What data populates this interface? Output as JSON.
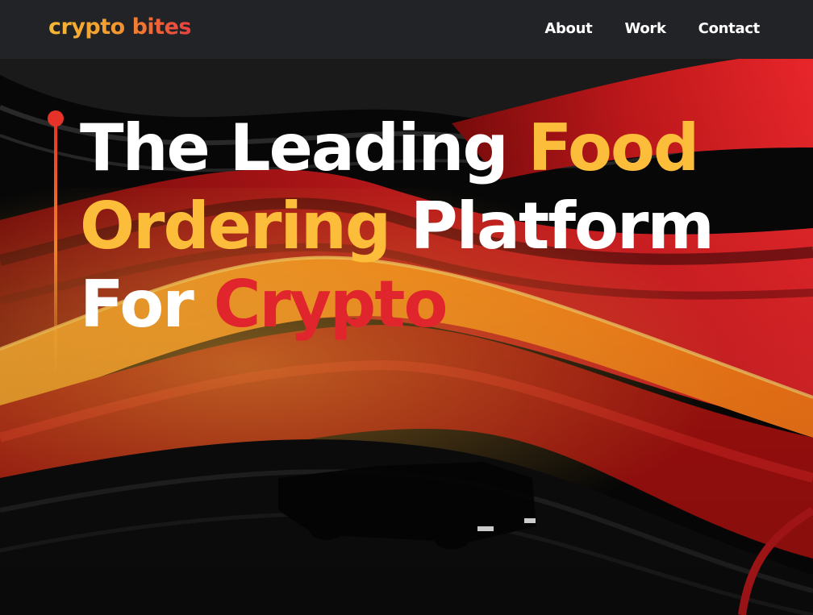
{
  "header": {
    "logo_text": "crypto bites",
    "nav": [
      {
        "label": "About"
      },
      {
        "label": "Work"
      },
      {
        "label": "Contact"
      }
    ]
  },
  "hero": {
    "headline": {
      "line1": {
        "part1": "The Leading",
        "part2": "Food"
      },
      "line2": {
        "part1": "Ordering",
        "part2": "Platform"
      },
      "line3": {
        "part1": "For",
        "part2": "Crypto"
      }
    }
  },
  "colors": {
    "nav_bg": "#222327",
    "accent_yellow": "#fbbd3a",
    "accent_red": "#e0262c",
    "text_white": "#ffffff"
  }
}
